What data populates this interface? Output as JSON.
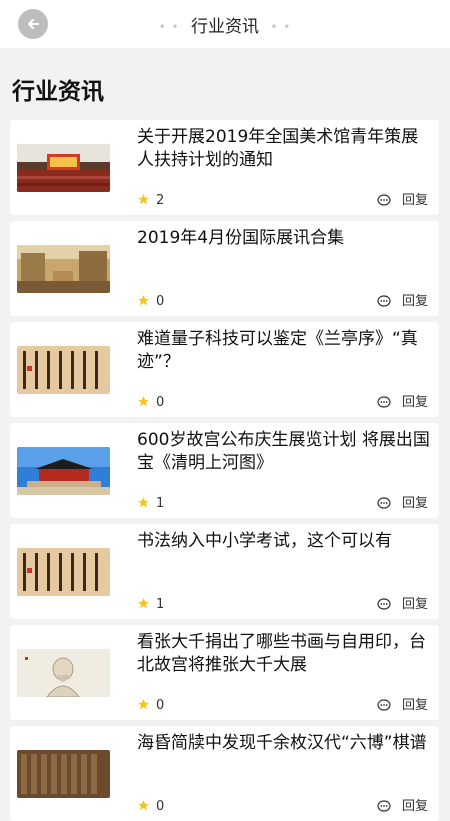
{
  "header": {
    "title": "行业资讯",
    "left_dots": "• •",
    "right_dots": "• •"
  },
  "section": {
    "title": "行业资讯"
  },
  "reply_label": "回复",
  "articles": [
    {
      "title": "关于开展2019年全国美术馆青年策展人扶持计划的通知",
      "count": "2"
    },
    {
      "title": "2019年4月份国际展讯合集",
      "count": "0"
    },
    {
      "title": "难道量子科技可以鉴定《兰亭序》“真迹”？",
      "count": "0"
    },
    {
      "title": "600岁故宫公布庆生展览计划 将展出国宝《清明上河图》",
      "count": "1"
    },
    {
      "title": "书法纳入中小学考试，这个可以有",
      "count": "1"
    },
    {
      "title": "看张大千捐出了哪些书画与自用印，台北故宫将推张大千大展",
      "count": "0"
    },
    {
      "title": "海昏简牍中发现千余枚汉代“六博”棋谱",
      "count": "0"
    }
  ],
  "icons": {
    "back": "arrow-left-icon",
    "star": "star-icon",
    "reply": "comment-icon"
  },
  "colors": {
    "star": "#f5c518",
    "background": "#f2f2f2"
  }
}
